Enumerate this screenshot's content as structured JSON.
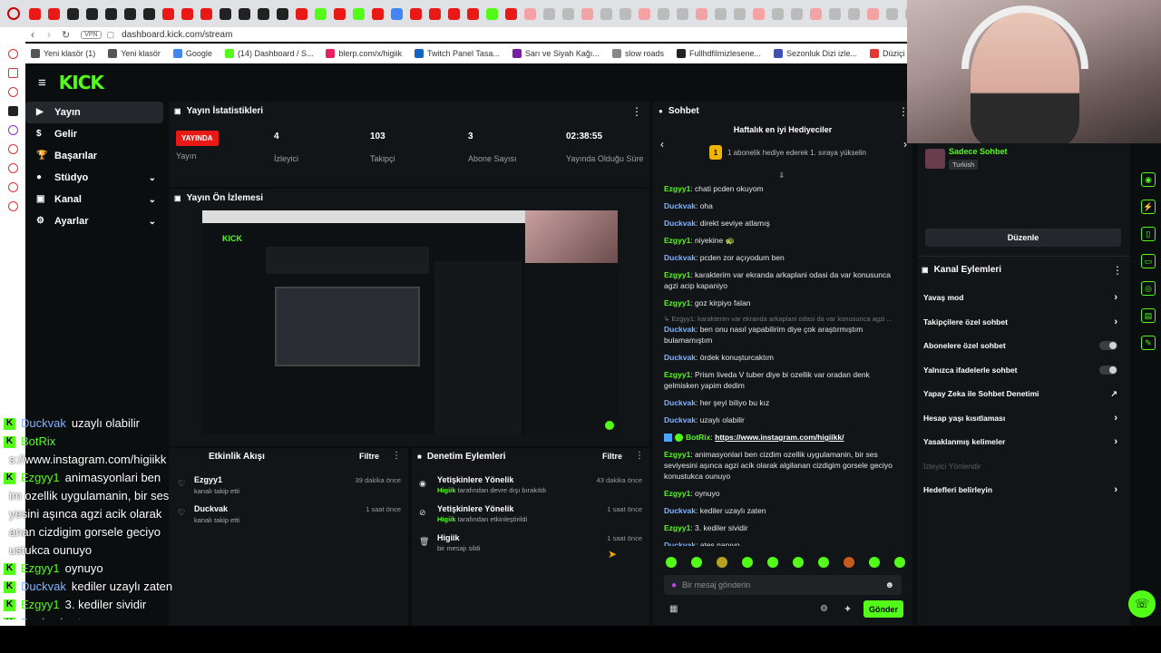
{
  "browser": {
    "url": "dashboard.kick.com/stream",
    "vpn_label": "VPN",
    "bookmarks": [
      {
        "label": "Yeni klasör (1)",
        "color": "#555555"
      },
      {
        "label": "Yeni klasör",
        "color": "#555555"
      },
      {
        "label": "Google",
        "color": "#4285f4"
      },
      {
        "label": "(14) Dashboard / S...",
        "color": "#53fc18"
      },
      {
        "label": "blerp.com/x/higiik",
        "color": "#e91e63"
      },
      {
        "label": "Twitch Panel Tasa...",
        "color": "#1565c0"
      },
      {
        "label": "Sarı ve Siyah Kağı...",
        "color": "#7b1fa2"
      },
      {
        "label": "slow roads",
        "color": "#888888"
      },
      {
        "label": "Fullhdfilmizlesene...",
        "color": "#222222"
      },
      {
        "label": "Sezonluk Dizi izle...",
        "color": "#3f51b5"
      },
      {
        "label": "Düziçi Namaz Vak...",
        "color": "#e53935"
      }
    ],
    "tab_colors": [
      "#e91916",
      "#e91916",
      "#222",
      "#222",
      "#222",
      "#222",
      "#222",
      "#e91916",
      "#e91916",
      "#e91916",
      "#222",
      "#222",
      "#222",
      "#222",
      "#e91916",
      "#53fc18",
      "#e91916",
      "#53fc18",
      "#e91916",
      "#4285f4",
      "#e91916",
      "#e91916",
      "#e91916",
      "#e91916",
      "#53fc18",
      "#e91916"
    ]
  },
  "nav": {
    "logo": "KICK",
    "items": [
      {
        "label": "Yayın",
        "icon": "broadcast-icon"
      },
      {
        "label": "Gelir",
        "icon": "revenue-icon"
      },
      {
        "label": "Başarılar",
        "icon": "trophy-icon"
      },
      {
        "label": "Stüdyo",
        "icon": "studio-icon"
      },
      {
        "label": "Kanal",
        "icon": "channel-icon"
      },
      {
        "label": "Ayarlar",
        "icon": "settings-icon"
      }
    ]
  },
  "stats": {
    "title": "Yayın İstatistikleri",
    "live": "YAYINDA",
    "live_label": "Yayın",
    "items": [
      {
        "value": "4",
        "label": "İzleyici"
      },
      {
        "value": "103",
        "label": "Takipçi"
      },
      {
        "value": "3",
        "label": "Abone Sayısı"
      },
      {
        "value": "02:38:55",
        "label": "Yayında Olduğu Süre"
      }
    ]
  },
  "preview": {
    "title": "Yayın Ön İzlemesi"
  },
  "activity": {
    "title": "Etkinlik Akışı",
    "filter": "Filtre",
    "items": [
      {
        "name": "Ezgyy1",
        "sub": "kanalı takip etti",
        "time": "39 dakika önce"
      },
      {
        "name": "Duckvak",
        "sub": "kanalı takip etti",
        "time": "1 saat önce"
      }
    ]
  },
  "moderation": {
    "title": "Denetim Eylemleri",
    "filter": "Filtre",
    "items": [
      {
        "name": "Yetişkinlere Yönelik",
        "by": "Higiik",
        "sub": "tarafından devre dışı bırakıldı",
        "time": "43 dakika önce",
        "icon": "eye-icon"
      },
      {
        "name": "Yetişkinlere Yönelik",
        "by": "Higiik",
        "sub": "tarafından etkinleştirildi",
        "time": "1 saat önce",
        "icon": "eye-off-icon"
      },
      {
        "name": "Higiik",
        "by": "",
        "sub": "bir mesajı sildi",
        "time": "1 saat önce",
        "icon": "trash-icon"
      }
    ]
  },
  "chat": {
    "title": "Sohbet",
    "gift_title": "Haftalık en iyi Hediyeciler",
    "gift_badge": "1",
    "gift_text": "1 abonelik hediye ederek 1. sıraya yükselin",
    "messages": [
      {
        "user": "Ezgyy1",
        "color": "#53fc18",
        "text": "chati pcden okuyom"
      },
      {
        "user": "Duckvak",
        "color": "#7fb3ff",
        "text": "oha"
      },
      {
        "user": "Duckvak",
        "color": "#7fb3ff",
        "text": "direkt seviye atlamış"
      },
      {
        "user": "Ezgyy1",
        "color": "#53fc18",
        "text": "niyekine 🐢"
      },
      {
        "user": "Duckvak",
        "color": "#7fb3ff",
        "text": "pcden zor açıyodum ben"
      },
      {
        "user": "Ezgyy1",
        "color": "#53fc18",
        "text": "karakterim var ekranda arkaplani odasi da var konusunca agzi acip kapaniyo"
      },
      {
        "user": "Ezgyy1",
        "color": "#53fc18",
        "text": "goz kirpiyo falan"
      },
      {
        "user": "Duckvak",
        "color": "#7fb3ff",
        "text": "ben onu nasıl yapabilirim diye çok araştırmıştım bulamamıştım",
        "reply": "↳ Ezgyy1: karakterim var ekranda arkaplani odasi da var konusunca agzi ..."
      },
      {
        "user": "Duckvak",
        "color": "#7fb3ff",
        "text": "ördek konuşturcaktım"
      },
      {
        "user": "Ezgyy1",
        "color": "#53fc18",
        "text": "Prism liveda V tuber diye bi ozellik var oradan denk gelmisken yapim dedim"
      },
      {
        "user": "Duckvak",
        "color": "#7fb3ff",
        "text": "her şeyi biliyo bu kız"
      },
      {
        "user": "Duckvak",
        "color": "#7fb3ff",
        "text": "uzaylı olabilir"
      },
      {
        "user": "BotRix",
        "color": "#53fc18",
        "text": "https://www.instagram.com/higiikk/",
        "link": true
      },
      {
        "user": "Ezgyy1",
        "color": "#53fc18",
        "text": "animasyonlari ben cizdim ozellik uygulamanin, bir ses seviyesini aşınca agzi acik olarak algilanan cizdigim gorsele geciyo konustukca ounuyo"
      },
      {
        "user": "Ezgyy1",
        "color": "#53fc18",
        "text": "oynuyo"
      },
      {
        "user": "Duckvak",
        "color": "#7fb3ff",
        "text": "kediler uzaylı zaten"
      },
      {
        "user": "Ezgyy1",
        "color": "#53fc18",
        "text": "3. kediler sividir"
      },
      {
        "user": "Duckvak",
        "color": "#7fb3ff",
        "text": "ateş napıyo"
      }
    ],
    "placeholder": "Bir mesaj gönderin",
    "send": "Gönder"
  },
  "right": {
    "mode": "Sadece Sohbet",
    "lang": "Turkish",
    "edit": "Düzenle",
    "actions_title": "Kanal Eylemleri",
    "actions": [
      {
        "label": "Yavaş mod",
        "kind": "chevron"
      },
      {
        "label": "Takipçilere özel sohbet",
        "kind": "chevron"
      },
      {
        "label": "Abonelere özel sohbet",
        "kind": "toggle"
      },
      {
        "label": "Yalnızca ifadelerle sohbet",
        "kind": "toggle"
      },
      {
        "label": "Yapay Zeka ile Sohbet Denetimi",
        "kind": "external"
      },
      {
        "label": "Hesap yaşı kısıtlaması",
        "kind": "chevron"
      },
      {
        "label": "Yasaklanmış kelimeler",
        "kind": "chevron"
      },
      {
        "label": "İzleyici Yönlendir",
        "kind": "disabled"
      },
      {
        "label": "Hedefleri belirleyin",
        "kind": "chevron"
      }
    ]
  },
  "overlay": {
    "lines": [
      {
        "user": "Duckvak",
        "text": "uzaylı olabilir",
        "color": "#7fb3ff",
        "badge": true
      },
      {
        "user": "BotRix",
        "text": "",
        "color": "#53fc18",
        "badge": true
      },
      {
        "user": "",
        "text": "s://www.instagram.com/higiikk",
        "color": "#fff",
        "badge": false
      },
      {
        "user": "Ezgyy1",
        "text": "animasyonlari ben",
        "color": "#53fc18",
        "badge": true
      },
      {
        "user": "",
        "text": "im ozellik uygulamanin, bir ses",
        "color": "#fff",
        "badge": false
      },
      {
        "user": "",
        "text": "yesini aşınca agzi acik olarak",
        "color": "#fff",
        "badge": false
      },
      {
        "user": "",
        "text": "anan cizdigim gorsele geciyo",
        "color": "#fff",
        "badge": false
      },
      {
        "user": "",
        "text": "ustukca ounuyo",
        "color": "#fff",
        "badge": false
      },
      {
        "user": "Ezgyy1",
        "text": "oynuyo",
        "color": "#53fc18",
        "badge": true
      },
      {
        "user": "Duckvak",
        "text": "kediler uzaylı zaten",
        "color": "#7fb3ff",
        "badge": true
      },
      {
        "user": "Ezgyy1",
        "text": "3. kediler sividir",
        "color": "#53fc18",
        "badge": true
      },
      {
        "user": "Duckvak",
        "text": "ateş napıyo",
        "color": "#7fb3ff",
        "badge": true
      }
    ]
  }
}
